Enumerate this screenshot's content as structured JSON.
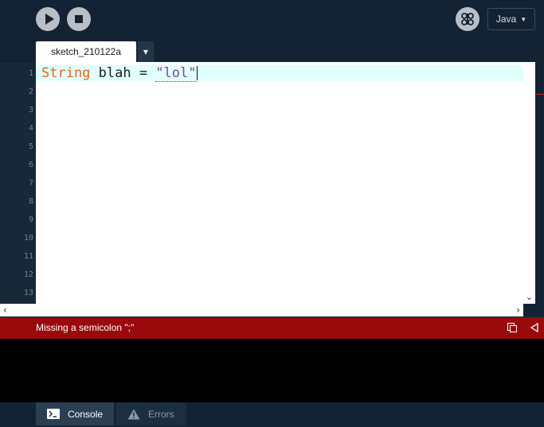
{
  "toolbar": {
    "run_icon": "play-icon",
    "stop_icon": "stop-icon",
    "debug_icon": "butterfly-icon",
    "mode_label": "Java"
  },
  "tabs": [
    {
      "label": "sketch_210122a"
    }
  ],
  "editor": {
    "line_numbers": [
      "1",
      "2",
      "3",
      "4",
      "5",
      "6",
      "7",
      "8",
      "9",
      "10",
      "11",
      "12",
      "13"
    ],
    "code": {
      "type_keyword": "String",
      "variable": " blah = ",
      "string_literal": "\"lol\""
    }
  },
  "status": {
    "message": "Missing a semicolon \";\"",
    "color": "#9a0a0d"
  },
  "bottom_tabs": {
    "console_label": "Console",
    "errors_label": "Errors"
  },
  "colors": {
    "background": "#142333",
    "keyword": "#e2661a",
    "string": "#7d4793",
    "current_line": "#e0fffd"
  }
}
